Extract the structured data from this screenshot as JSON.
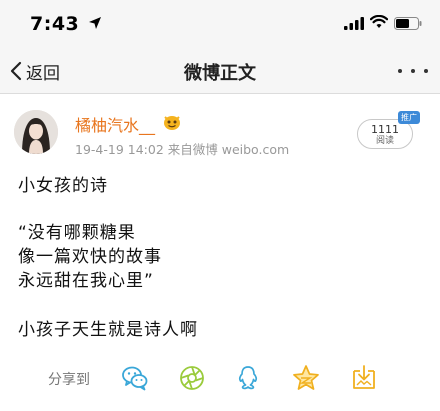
{
  "status_bar": {
    "time": "7:43"
  },
  "nav": {
    "back_label": "返回",
    "title": "微博正文"
  },
  "post": {
    "username": "橘柚汽水__",
    "meta": "19-4-19 14:02  来自微博 weibo.com",
    "read_count": "1111",
    "read_label": "阅读",
    "promo_badge": "推广",
    "lines": [
      "小女孩的诗",
      "“没有哪颗糖果",
      "像一篇欢快的故事",
      "永远甜在我心里”",
      "小孩子天生就是诗人啊"
    ]
  },
  "share": {
    "label": "分享到",
    "icons": [
      "wechat-icon",
      "moments-icon",
      "qq-icon",
      "qzone-icon",
      "save-image-icon"
    ]
  },
  "colors": {
    "username": "#e8761f",
    "share_icon": "#3aa7d8",
    "promo": "#3d8ad8"
  }
}
